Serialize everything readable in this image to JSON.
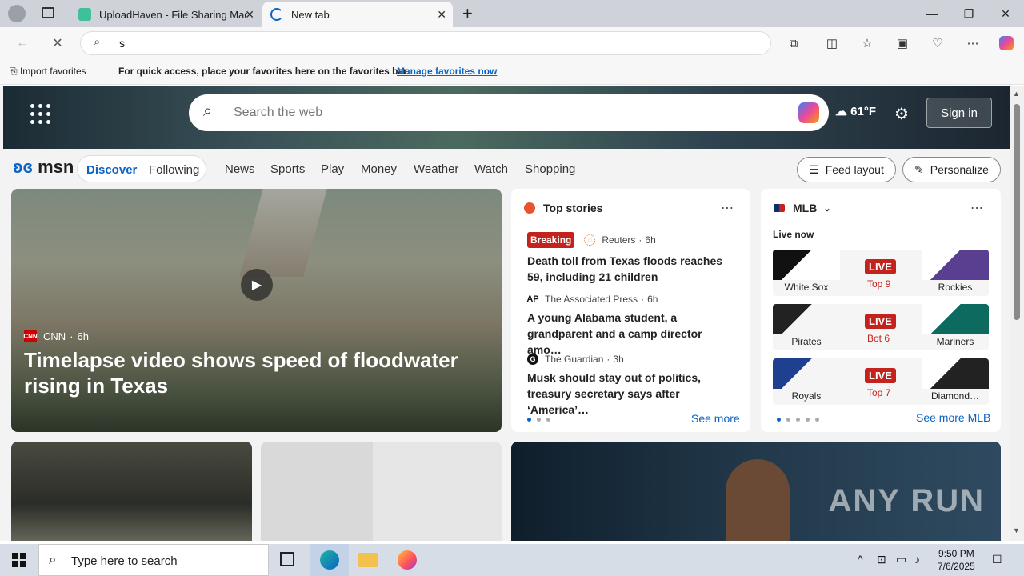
{
  "browser": {
    "tabs": [
      {
        "title": "UploadHaven - File Sharing Made",
        "active": false
      },
      {
        "title": "New tab",
        "active": true
      }
    ],
    "address_value": "s",
    "favorites_bar": {
      "import": "Import favorites",
      "message": "For quick access, place your favorites here on the favorites bar.",
      "link": "Manage favorites now"
    }
  },
  "msn": {
    "search_placeholder": "Search the web",
    "weather": "61°F",
    "sign_in": "Sign in",
    "logo": "msn",
    "pills": [
      "Discover",
      "Following"
    ],
    "nav": [
      "News",
      "Sports",
      "Play",
      "Money",
      "Weather",
      "Watch",
      "Shopping"
    ],
    "feed_layout": "Feed layout",
    "personalize": "Personalize"
  },
  "main_story": {
    "source": "CNN",
    "source_badge": "CNN",
    "age": "6h",
    "title": "Timelapse video shows speed of floodwater rising in Texas"
  },
  "top_stories": {
    "heading": "Top stories",
    "items": [
      {
        "badge": "Breaking",
        "source": "Reuters",
        "age": "6h",
        "title": "Death toll from Texas floods reaches 59, including 21 children"
      },
      {
        "badge": "",
        "source": "The Associated Press",
        "age": "6h",
        "title": "A young Alabama student, a grandparent and a camp director amo…"
      },
      {
        "badge": "",
        "source": "The Guardian",
        "age": "3h",
        "title": "Musk should stay out of politics, treasury secretary says after ‘America’…"
      }
    ],
    "see_more": "See more"
  },
  "mlb": {
    "heading": "MLB",
    "live_now": "Live now",
    "games": [
      {
        "left": "White Sox",
        "right": "Rockies",
        "status": "LIVE",
        "inning": "Top 9",
        "left_color": "#111111",
        "right_color": "#5a3e8f"
      },
      {
        "left": "Pirates",
        "right": "Mariners",
        "status": "LIVE",
        "inning": "Bot 6",
        "left_color": "#222222",
        "right_color": "#0c6b5e"
      },
      {
        "left": "Royals",
        "right": "Diamond…",
        "status": "LIVE",
        "inning": "Top 7",
        "left_color": "#1f3f8f",
        "right_color": "#222222"
      }
    ],
    "see_more": "See more MLB"
  },
  "watermark": "ANY RUN",
  "taskbar": {
    "search_placeholder": "Type here to search",
    "time": "9:50 PM",
    "date": "7/6/2025"
  }
}
